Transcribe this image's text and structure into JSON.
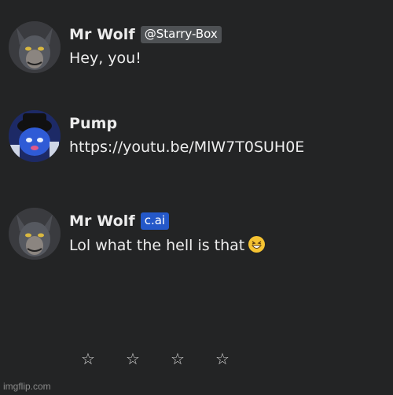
{
  "messages": [
    {
      "name": "Mr Wolf",
      "tag": "@Starry-Box",
      "text": "Hey, you!"
    },
    {
      "name": "Pump",
      "text": "https://youtu.be/MlW7T0SUH0E"
    },
    {
      "name": "Mr Wolf",
      "tag": "c.ai",
      "text": "Lol what the hell is that",
      "emoji": "grinning-squint-face"
    }
  ],
  "rating": {
    "stars": [
      "☆",
      "☆",
      "☆",
      "☆"
    ]
  },
  "watermark": "imgflip.com",
  "colors": {
    "background": "#232425",
    "tag_grey": "#4e5154",
    "tag_blue": "#2458c9"
  }
}
